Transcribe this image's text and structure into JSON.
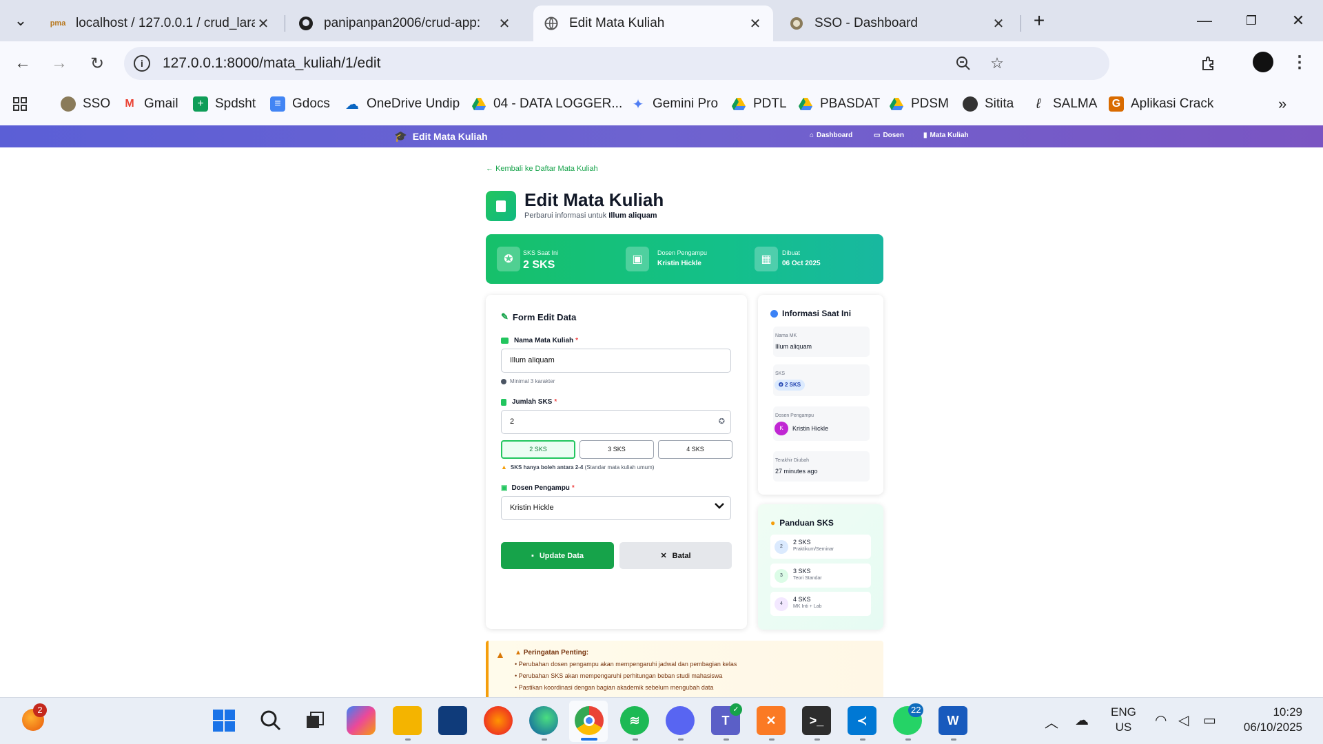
{
  "browser": {
    "tabs": [
      {
        "label": "localhost / 127.0.0.1 / crud_lara",
        "icon": "phpmyadmin-icon"
      },
      {
        "label": "panipanpan2006/crud-app: ",
        "icon": "github-icon"
      },
      {
        "label": "Edit Mata Kuliah",
        "icon": "globe-icon"
      },
      {
        "label": "SSO - Dashboard",
        "icon": "undip-icon"
      }
    ],
    "url": "127.0.0.1:8000/mata_kuliah/1/edit",
    "bookmarks": [
      {
        "label": "SSO",
        "icon": "undip-icon"
      },
      {
        "label": "Gmail",
        "icon": "gmail-icon"
      },
      {
        "label": "Spdsht",
        "icon": "sheets-icon"
      },
      {
        "label": "Gdocs",
        "icon": "docs-icon"
      },
      {
        "label": "OneDrive Undip",
        "icon": "onedrive-icon"
      },
      {
        "label": "04 - DATA LOGGER...",
        "icon": "drive-icon"
      },
      {
        "label": "Gemini Pro",
        "icon": "gemini-icon"
      },
      {
        "label": "PDTL",
        "icon": "drive-icon"
      },
      {
        "label": "PBASDAT",
        "icon": "drive-icon"
      },
      {
        "label": "PDSM",
        "icon": "drive-icon"
      },
      {
        "label": "Sitita",
        "icon": "globe-icon"
      },
      {
        "label": "SALMA",
        "icon": "salma-icon"
      },
      {
        "label": "Aplikasi Crack",
        "icon": "g-icon"
      }
    ]
  },
  "topnav": {
    "brand": "Edit Mata Kuliah",
    "links": [
      "Dashboard",
      "Dosen",
      "Mata Kuliah"
    ]
  },
  "header": {
    "back": "Kembali ke Daftar Mata Kuliah",
    "title": "Edit Mata Kuliah",
    "subtitle_prefix": "Perbarui informasi untuk",
    "subtitle_name": "Illum aliquam"
  },
  "stats": [
    {
      "label": "SKS Saat Ini",
      "value": "2 SKS"
    },
    {
      "label": "Dosen Pengampu",
      "value": "Kristin Hickle"
    },
    {
      "label": "Dibuat",
      "value": "06 Oct 2025"
    }
  ],
  "form": {
    "title": "Form Edit Data",
    "nama_label": "Nama Mata Kuliah",
    "nama_value": "Illum aliquam",
    "nama_hint": "Minimal 3 karakter",
    "sks_label": "Jumlah SKS",
    "sks_value": "2",
    "sks_options": [
      "2 SKS",
      "3 SKS",
      "4 SKS"
    ],
    "sks_hint_bold": "SKS hanya boleh antara 2-4",
    "sks_hint_rest": "(Standar mata kuliah umum)",
    "dosen_label": "Dosen Pengampu",
    "dosen_value": "Kristin Hickle",
    "required_mark": "*",
    "update_label": "Update Data",
    "cancel_label": "Batal"
  },
  "info": {
    "title": "Informasi Saat Ini",
    "nama_label": "Nama MK",
    "nama_value": "Illum aliquam",
    "sks_label": "SKS",
    "sks_value": "2 SKS",
    "dosen_label": "Dosen Pengampu",
    "dosen_initial": "K",
    "dosen_value": "Kristin Hickle",
    "updated_label": "Terakhir Diubah",
    "updated_value": "27 minutes ago"
  },
  "guide": {
    "title": "Panduan SKS",
    "items": [
      {
        "num": "2",
        "title": "2 SKS",
        "sub": "Praktikum/Seminar"
      },
      {
        "num": "3",
        "title": "3 SKS",
        "sub": "Teori Standar"
      },
      {
        "num": "4",
        "title": "4 SKS",
        "sub": "MK Inti + Lab"
      }
    ]
  },
  "warning": {
    "title": "Peringatan Penting:",
    "items": [
      "• Perubahan dosen pengampu akan mempengaruhi jadwal dan pembagian kelas",
      "• Perubahan SKS akan mempengaruhi perhitungan beban studi mahasiswa",
      "• Pastikan koordinasi dengan bagian akademik sebelum mengubah data"
    ]
  },
  "taskbar": {
    "lang_1": "ENG",
    "lang_2": "US",
    "time": "10:29",
    "date": "06/10/2025",
    "badge_left": "2",
    "badge_whatsapp": "22"
  },
  "colors": {
    "accent": "#16a34a",
    "nav_gradient_start": "#5b5fd6",
    "nav_gradient_end": "#7a55c2",
    "warning": "#f59e0b"
  }
}
